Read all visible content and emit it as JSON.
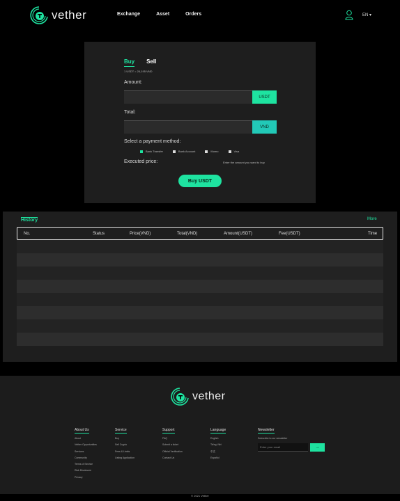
{
  "header": {
    "brand": "vether",
    "nav": [
      "Exchange",
      "Asset",
      "Orders"
    ],
    "language": "EN ▾"
  },
  "trade": {
    "tabs": [
      "Buy",
      "Sell"
    ],
    "rate_text": "1 USDT = 24,195 VND",
    "amount_label": "Amount:",
    "amount_unit": "USDT",
    "total_label": "Total:",
    "total_unit": "VND",
    "payment_label": "Select a payment method:",
    "payments": [
      "Bank Transfer",
      "Bank Account",
      "Momo",
      "Visa"
    ],
    "executed_label": "Executed price:",
    "executed_note": "Enter the amount you want to buy",
    "buy_button": "Buy USDT"
  },
  "history": {
    "title": "History",
    "more": "More",
    "columns": [
      "No.",
      "Status",
      "Price(VND)",
      "Total(VND)",
      "Amount(USDT)",
      "Fee(USDT)",
      "Time"
    ],
    "rows": [
      [],
      [],
      [],
      [],
      [],
      [],
      [],
      []
    ]
  },
  "footer": {
    "brand": "vether",
    "about": {
      "title": "About Us",
      "items": [
        "About",
        "Vether Opportunities",
        "Services",
        "Community",
        "Terms of Service",
        "Risk Disclosure",
        "Privacy"
      ]
    },
    "service": {
      "title": "Service",
      "items": [
        "Buy",
        "Sell Crypto",
        "Fees & Limits",
        "Listing Application"
      ]
    },
    "support": {
      "title": "Support",
      "items": [
        "FAQ",
        "Submit a ticket",
        "Official Verification",
        "Contact Us"
      ]
    },
    "language": {
      "title": "Language",
      "items": [
        "English",
        "Tiếng Việt",
        "中文",
        "Español"
      ]
    },
    "newsletter": {
      "title": "Newsletter",
      "desc": "Subscribe to our newsletter",
      "placeholder": "Enter your email",
      "button": "→"
    },
    "copyright": "© 2021 Vether"
  },
  "colors": {
    "accent": "#1ee3a0",
    "accent2": "#22c9b7",
    "background": "#000000",
    "panel": "#1e1e1e"
  }
}
